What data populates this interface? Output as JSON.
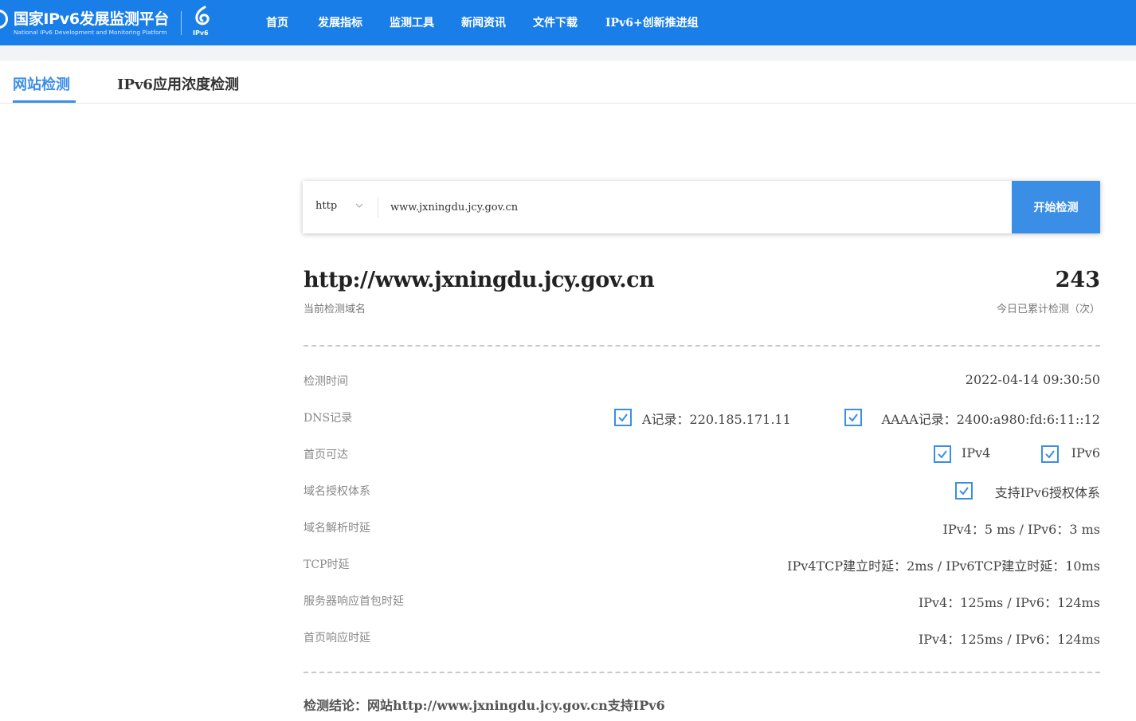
{
  "header": {
    "logo_cn": "国家IPv6发展监测平台",
    "logo_en": "National IPv6 Development and Monitoring Platform",
    "ipv6_label": "IPv6",
    "nav": [
      "首页",
      "发展指标",
      "监测工具",
      "新闻资讯",
      "文件下载",
      "IPv6+创新推进组"
    ]
  },
  "tabs": [
    "网站检测",
    "IPv6应用浓度检测"
  ],
  "search": {
    "protocol": "http",
    "url_value": "www.jxningdu.jcy.gov.cn",
    "button_label": "开始检测"
  },
  "result": {
    "domain": "http://www.jxningdu.jcy.gov.cn",
    "domain_caption": "当前检测域名",
    "count": "243",
    "count_caption": "今日已累计检测（次）",
    "rows": {
      "time_label": "检测时间",
      "time_value": "2022-04-14 09:30:50",
      "dns_label": "DNS记录",
      "dns_a": "A记录：220.185.171.11",
      "dns_aaaa": "AAAA记录：2400:a980:fd:6:11::12",
      "home_label": "首页可达",
      "home_v4": "IPv4",
      "home_v6": "IPv6",
      "auth_label": "域名授权体系",
      "auth_value": "支持IPv6授权体系",
      "resolve_label": "域名解析时延",
      "resolve_value": "IPv4：5 ms / IPv6：3 ms",
      "tcp_label": "TCP时延",
      "tcp_value": "IPv4TCP建立时延：2ms / IPv6TCP建立时延：10ms",
      "server_label": "服务器响应首包时延",
      "server_value": "IPv4：125ms / IPv6：124ms",
      "homeresp_label": "首页响应时延",
      "homeresp_value": "IPv4：125ms / IPv6：124ms"
    },
    "conclusion": "检测结论：网站http://www.jxningdu.jcy.gov.cn支持IPv6"
  },
  "colors": {
    "header_bg": "#1a7ee8",
    "accent": "#3a8ee6"
  }
}
